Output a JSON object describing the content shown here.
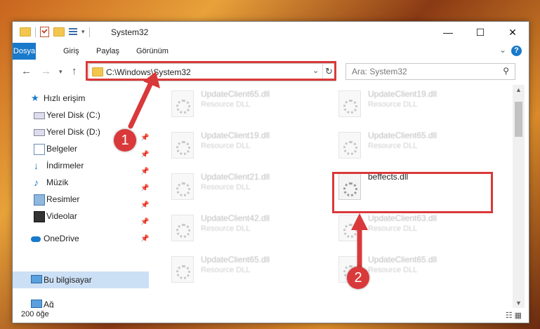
{
  "window": {
    "title": "System32",
    "controls": {
      "minimize": "—",
      "maximize": "☐",
      "close": "✕"
    }
  },
  "ribbon": {
    "tabs": [
      "Dosya",
      "Giriş",
      "Paylaş",
      "Görünüm"
    ],
    "help": "?",
    "collapse": "⌄"
  },
  "address_bar": {
    "path": "C:\\Windows\\System32",
    "search_placeholder": "Ara: System32"
  },
  "sidebar": {
    "items": [
      {
        "label": "Hızlı erişim",
        "icon": "star-icon",
        "pinned": false
      },
      {
        "label": "Yerel Disk (C:)",
        "icon": "drive-icon",
        "pinned": true
      },
      {
        "label": "Yerel Disk (D:)",
        "icon": "drive-icon",
        "pinned": true
      },
      {
        "label": "Belgeler",
        "icon": "documents-icon",
        "pinned": true
      },
      {
        "label": "İndirmeler",
        "icon": "download-icon",
        "pinned": true
      },
      {
        "label": "Müzik",
        "icon": "music-icon",
        "pinned": true
      },
      {
        "label": "Resimler",
        "icon": "pictures-icon",
        "pinned": true
      },
      {
        "label": "Videolar",
        "icon": "video-icon",
        "pinned": true
      },
      {
        "label": "OneDrive",
        "icon": "cloud-icon",
        "pinned": false
      },
      {
        "label": "Bu bilgisayar",
        "icon": "computer-icon",
        "pinned": false,
        "selected": true
      },
      {
        "label": "Ağ",
        "icon": "network-icon",
        "pinned": false
      }
    ]
  },
  "files": [
    {
      "name": "UpdateClient65.dll",
      "type": "Resource DLL"
    },
    {
      "name": "UpdateClient19.dll",
      "type": "Resource DLL"
    },
    {
      "name": "UpdateClient19.dll",
      "type": "Resource DLL"
    },
    {
      "name": "UpdateClient65.dll",
      "type": "Resource DLL"
    },
    {
      "name": "UpdateClient21.dll",
      "type": "Resource DLL"
    },
    {
      "name": "beffects.dll",
      "type": "",
      "selected": true
    },
    {
      "name": "UpdateClient42.dll",
      "type": "Resource DLL"
    },
    {
      "name": "UpdateClient63.dll",
      "type": "Resource DLL"
    },
    {
      "name": "UpdateClient65.dll",
      "type": "Resource DLL"
    },
    {
      "name": "UpdateClient65.dll",
      "type": "Resource DLL"
    }
  ],
  "status": {
    "count": "200 öğe"
  },
  "annotations": {
    "badge1": "1",
    "badge2": "2"
  },
  "colors": {
    "accent": "#1979ca",
    "highlight": "#d9393a",
    "selected_nav": "#cce0f5"
  }
}
